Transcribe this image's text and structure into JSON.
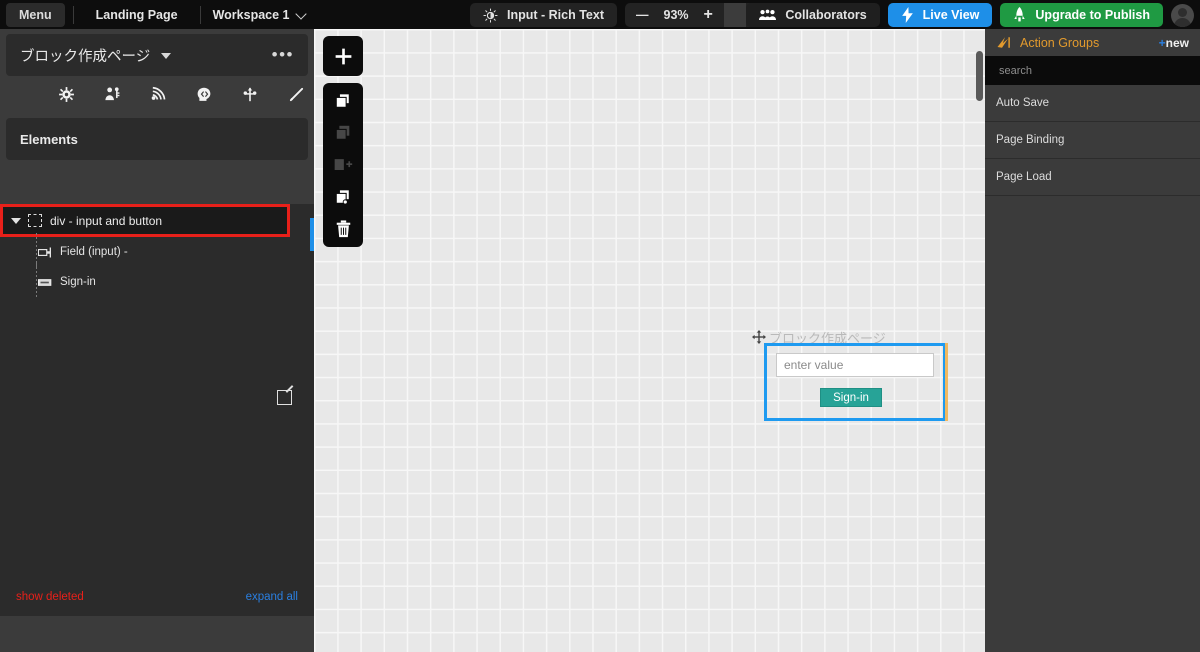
{
  "topbar": {
    "menu_label": "Menu",
    "page_tab": "Landing Page",
    "workspace": "Workspace 1",
    "mode_label": "Input - Rich Text",
    "zoom_level": "93%",
    "zoom_minus": "—",
    "zoom_plus": "+",
    "collaborators_label": "Collaborators",
    "live_view_label": "Live View",
    "upgrade_label": "Upgrade to Publish",
    "icons": {
      "brightness": "brightness-icon",
      "collaborators": "people-icon",
      "live_view": "lightning-icon",
      "upgrade": "rocket-icon",
      "avatar": "user-avatar-icon",
      "workspace_chevron": "chevron-down-icon",
      "zoom_chevron": "chevron-down-icon"
    }
  },
  "left_panel": {
    "page_title": "ブロック作成ページ",
    "more_dots": "•••",
    "tool_icons": [
      {
        "name": "gear-icon",
        "title": "settings"
      },
      {
        "name": "user-key-icon",
        "title": "privacy"
      },
      {
        "name": "broadcast-icon",
        "title": "api"
      },
      {
        "name": "head-code-icon",
        "title": "plugins"
      },
      {
        "name": "branch-icon",
        "title": "workflow"
      },
      {
        "name": "pen-icon",
        "title": "styles"
      }
    ],
    "elements_header": "Elements",
    "tree": {
      "root": {
        "label": "div - input and button",
        "icon": "dashed-box-icon",
        "expand_icon": "triangle-down-icon",
        "edit_icon": "edit-square-icon",
        "selected": true
      },
      "children": [
        {
          "label": "Field (input) -",
          "icon": "input-field-icon"
        },
        {
          "label": "Sign-in",
          "icon": "button-icon"
        }
      ]
    },
    "footer": {
      "show_deleted": "show deleted",
      "expand_all": "expand all"
    }
  },
  "canvas": {
    "toolbar": [
      {
        "name": "add-element-icon",
        "label": "+",
        "dim": false
      },
      {
        "name": "copy-icon",
        "label": "",
        "dim": false
      },
      {
        "name": "paste-icon",
        "label": "",
        "dim": true
      },
      {
        "name": "paste-add-icon",
        "label": "",
        "dim": true
      },
      {
        "name": "duplicate-icon",
        "label": "",
        "dim": false
      },
      {
        "name": "trash-icon",
        "label": "",
        "dim": false
      }
    ],
    "drop_label": "ブロック作成ページ",
    "move_handle_icon": "move-handle-icon",
    "input_placeholder": "enter value",
    "button_label": "Sign-in",
    "selection_color": "#1e9af0",
    "guide_color": "#f0b860",
    "button_color": "#27a397"
  },
  "right_panel": {
    "title": "Action Groups",
    "title_icon": "action-groups-icon",
    "new_plus": "+",
    "new_label": "new",
    "search_placeholder": "search",
    "items": [
      {
        "label": "Auto Save"
      },
      {
        "label": "Page Binding"
      },
      {
        "label": "Page Load"
      }
    ]
  }
}
